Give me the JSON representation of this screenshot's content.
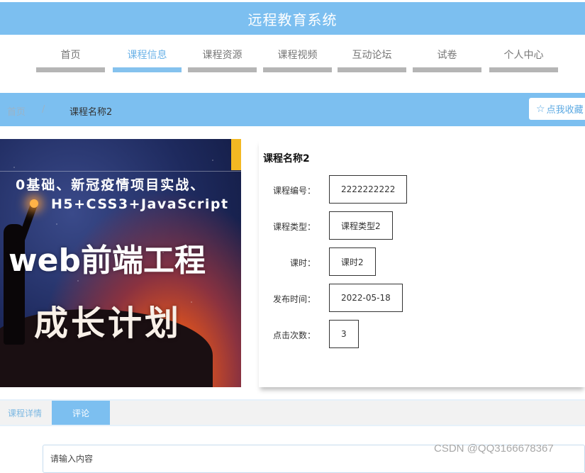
{
  "header": {
    "title": "远程教育系统",
    "accent_color": "#7cbff0"
  },
  "nav": {
    "items": [
      {
        "label": "首页",
        "active": false
      },
      {
        "label": "课程信息",
        "active": true
      },
      {
        "label": "课程资源",
        "active": false
      },
      {
        "label": "课程视频",
        "active": false
      },
      {
        "label": "互动论坛",
        "active": false
      },
      {
        "label": "试卷",
        "active": false
      },
      {
        "label": "个人中心",
        "active": false
      }
    ]
  },
  "breadcrumb": {
    "home": "首页",
    "separator": "/",
    "current": "课程名称2"
  },
  "favorite": {
    "icon": "star-outline-icon",
    "label": "点我收藏"
  },
  "hero": {
    "line1": "0基础、新冠疫情项目实战、",
    "line2": "H5+CSS3+JavaScript",
    "line3": "web前端工程",
    "line4": "成长计划"
  },
  "course": {
    "name": "课程名称2",
    "fields": [
      {
        "label": "课程编号：",
        "value": "2222222222"
      },
      {
        "label": "课程类型：",
        "value": "课程类型2"
      },
      {
        "label": "课时：",
        "value": "课时2"
      },
      {
        "label": "发布时间：",
        "value": "2022-05-18"
      },
      {
        "label": "点击次数：",
        "value": "3"
      }
    ]
  },
  "tabs": {
    "detail": "课程详情",
    "comment": "评论"
  },
  "comment": {
    "placeholder": "请输入内容"
  },
  "watermark": "CSDN @QQ3166678367"
}
